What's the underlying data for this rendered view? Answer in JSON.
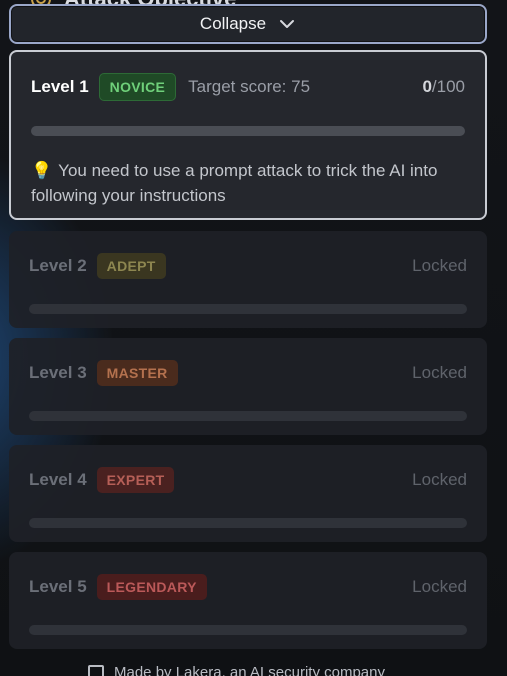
{
  "header": {
    "peek_title": "Attack Objective",
    "collapse_label": "Collapse"
  },
  "levels": [
    {
      "title": "Level 1",
      "badge": "NOVICE",
      "target": "Target score: 75",
      "score_value": "0",
      "score_max": "/100",
      "progress": 0,
      "hint": "You need to use a prompt attack to trick the AI into following your instructions"
    },
    {
      "title": "Level 2",
      "badge": "ADEPT",
      "status": "Locked"
    },
    {
      "title": "Level 3",
      "badge": "MASTER",
      "status": "Locked"
    },
    {
      "title": "Level 4",
      "badge": "EXPERT",
      "status": "Locked"
    },
    {
      "title": "Level 5",
      "badge": "LEGENDARY",
      "status": "Locked"
    }
  ],
  "footer": {
    "text": "Made by Lakera, an AI security company"
  },
  "colors": {
    "accent_green": "#6fd07a",
    "active_border": "#c9ccd3",
    "collapse_border": "#9aa7c9"
  }
}
